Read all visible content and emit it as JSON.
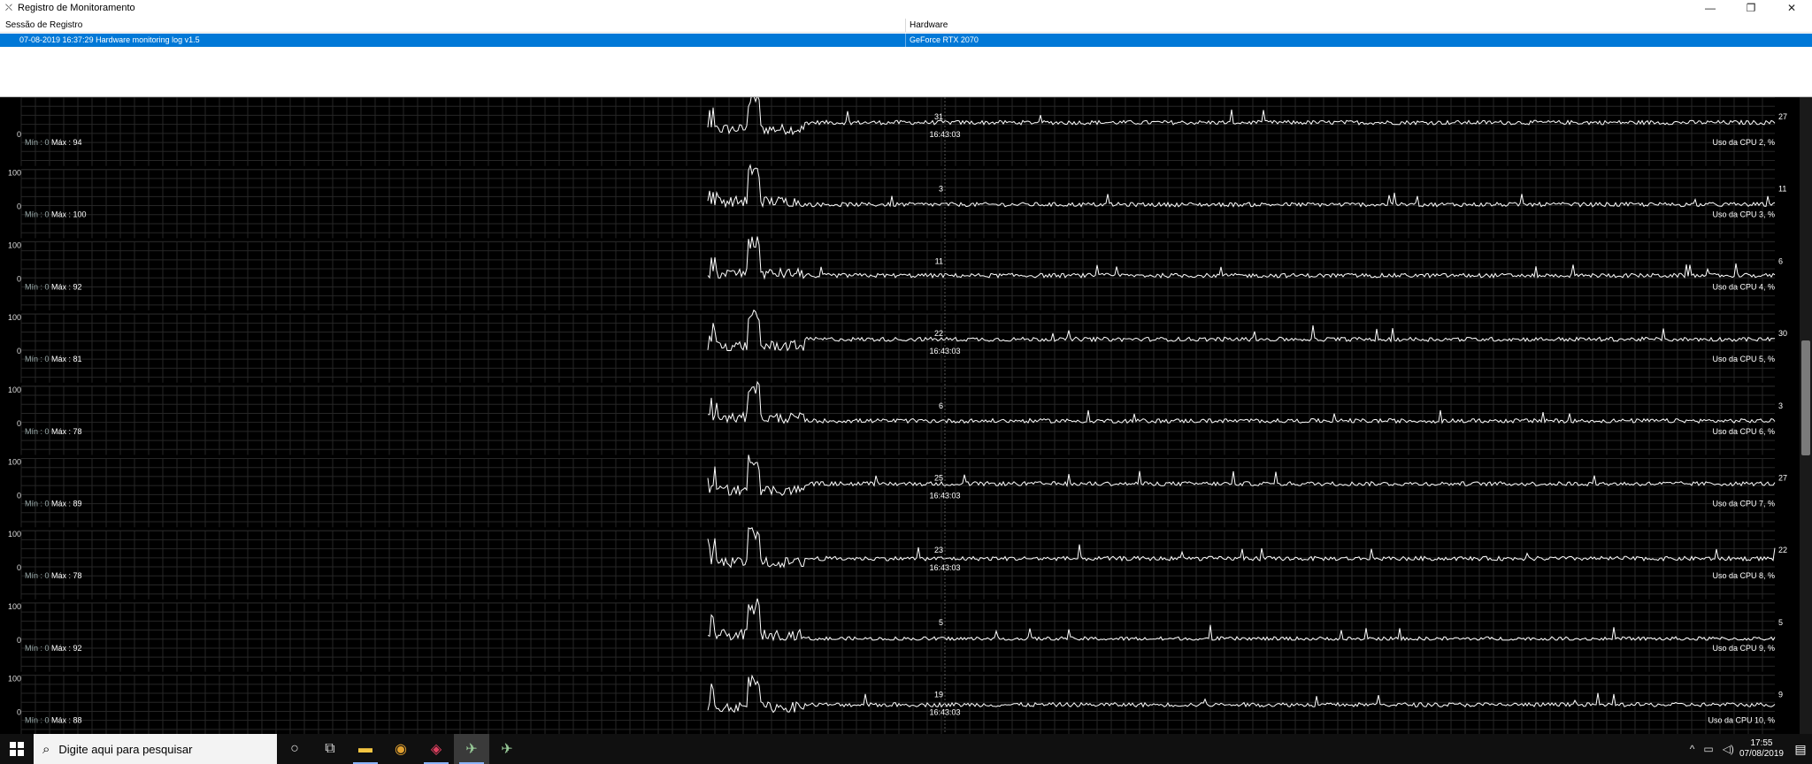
{
  "window": {
    "title": "Registro de Monitoramento",
    "minimize_glyph": "—",
    "maximize_glyph": "❐",
    "close_glyph": "✕"
  },
  "session_table": {
    "col_session": "Sessão de Registro",
    "col_hardware": "Hardware",
    "row": {
      "session": "07-08-2019 16:37:29 Hardware monitoring log v1.5",
      "hardware": "GeForce RTX 2070"
    }
  },
  "graphs": [
    {
      "label": "Uso da CPU 2, %",
      "min_text": "Mín : 0",
      "max_text": "Máx : 94",
      "axis_top": "",
      "axis_bottom": "0",
      "cursor_value": "31",
      "end_value": "27",
      "time": "16:43:03",
      "base": 28
    },
    {
      "label": "Uso da CPU 3, %",
      "min_text": "Mín : 0",
      "max_text": "Máx : 100",
      "axis_top": "100",
      "axis_bottom": "0",
      "cursor_value": "3",
      "end_value": "11",
      "time": "",
      "base": 5
    },
    {
      "label": "Uso da CPU 4, %",
      "min_text": "Mín : 0",
      "max_text": "Máx : 92",
      "axis_top": "100",
      "axis_bottom": "0",
      "cursor_value": "11",
      "end_value": "6",
      "time": "",
      "base": 8
    },
    {
      "label": "Uso da CPU 5, %",
      "min_text": "Mín : 0",
      "max_text": "Máx : 81",
      "axis_top": "100",
      "axis_bottom": "0",
      "cursor_value": "22",
      "end_value": "30",
      "time": "16:43:03",
      "base": 28
    },
    {
      "label": "Uso da CPU 6, %",
      "min_text": "Mín : 0",
      "max_text": "Máx : 78",
      "axis_top": "100",
      "axis_bottom": "0",
      "cursor_value": "6",
      "end_value": "3",
      "time": "",
      "base": 6
    },
    {
      "label": "Uso da CPU 7, %",
      "min_text": "Mín : 0",
      "max_text": "Máx : 89",
      "axis_top": "100",
      "axis_bottom": "0",
      "cursor_value": "25",
      "end_value": "27",
      "time": "16:43:03",
      "base": 28
    },
    {
      "label": "Uso da CPU 8, %",
      "min_text": "Mín : 0",
      "max_text": "Máx : 78",
      "axis_top": "100",
      "axis_bottom": "0",
      "cursor_value": "23",
      "end_value": "22",
      "time": "16:43:03",
      "base": 22
    },
    {
      "label": "Uso da CPU 9, %",
      "min_text": "Mín : 0",
      "max_text": "Máx : 92",
      "axis_top": "100",
      "axis_bottom": "0",
      "cursor_value": "5",
      "end_value": "5",
      "time": "",
      "base": 3
    },
    {
      "label": "Uso da CPU 10, %",
      "min_text": "Mín : 0",
      "max_text": "Máx : 88",
      "axis_top": "100",
      "axis_bottom": "0",
      "cursor_value": "19",
      "end_value": "9",
      "time": "16:43:03",
      "base": 18
    }
  ],
  "taskbar": {
    "search_placeholder": "Digite aqui para pesquisar",
    "time": "17:55",
    "date": "07/08/2019",
    "tray_up": "^",
    "tray_net": "▭",
    "tray_vol": "◁)",
    "notif_glyph": "▤"
  },
  "colors": {
    "selection": "#0078d7",
    "trace": "#ffffff",
    "grid": "#262626"
  }
}
